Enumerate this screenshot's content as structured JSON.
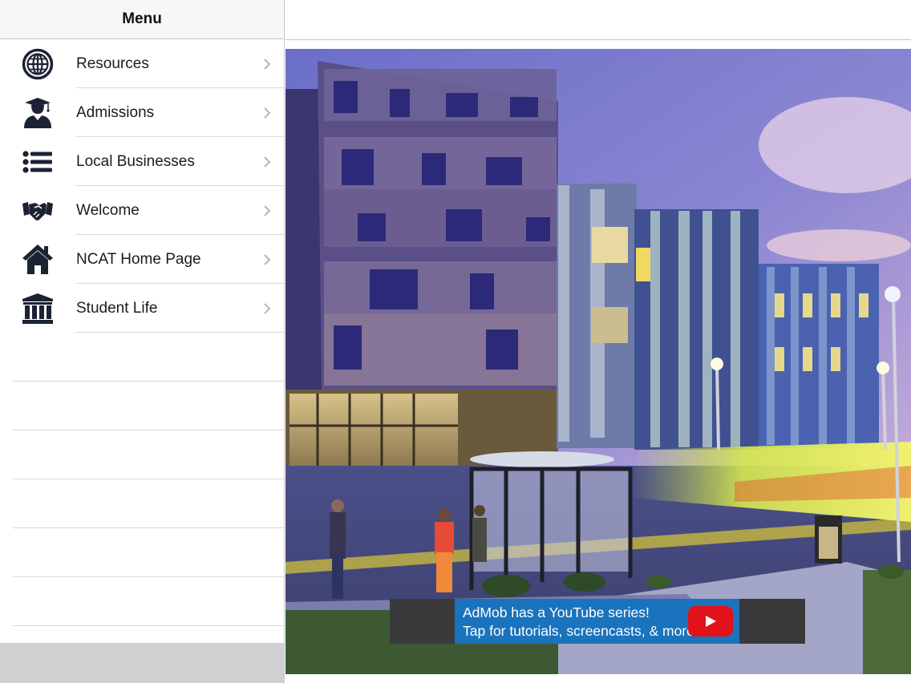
{
  "menu": {
    "title": "Menu",
    "items": [
      {
        "label": "Resources",
        "icon": "globe-icon"
      },
      {
        "label": "Admissions",
        "icon": "graduate-icon"
      },
      {
        "label": "Local Businesses",
        "icon": "list-icon"
      },
      {
        "label": "Welcome",
        "icon": "handshake-icon"
      },
      {
        "label": "NCAT Home Page",
        "icon": "home-icon"
      },
      {
        "label": "Student Life",
        "icon": "institution-icon"
      }
    ]
  },
  "ad": {
    "line1": "AdMob has a YouTube series!",
    "line2": "Tap for tutorials, screencasts, & more.",
    "icon": "youtube-play-icon"
  },
  "colors": {
    "icon_color": "#1b2233",
    "ad_blue": "#1a73bd",
    "youtube_red": "#e2121a"
  }
}
